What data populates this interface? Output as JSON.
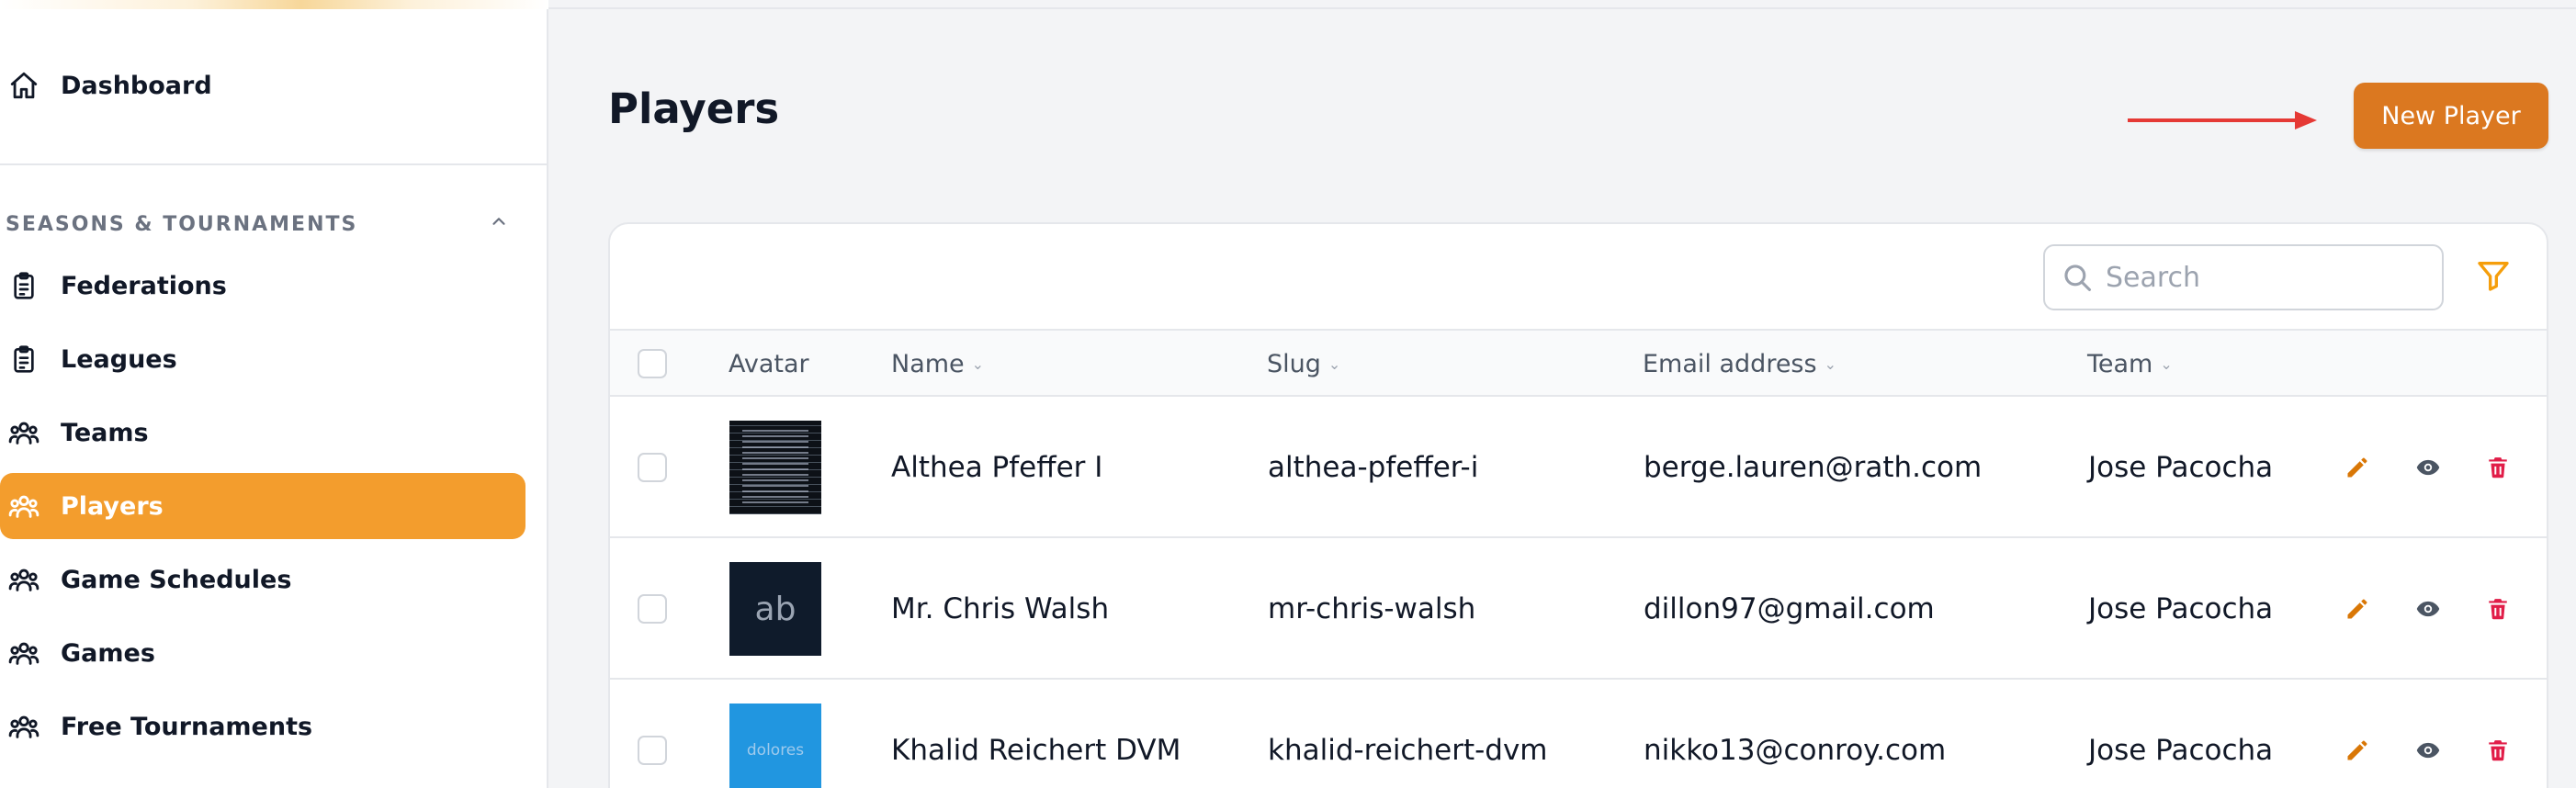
{
  "sidebar": {
    "items": [
      {
        "label": "Dashboard",
        "icon": "home-icon"
      },
      {
        "label": "Federations",
        "icon": "clipboard-icon"
      },
      {
        "label": "Leagues",
        "icon": "clipboard-icon"
      },
      {
        "label": "Teams",
        "icon": "users-icon"
      },
      {
        "label": "Players",
        "icon": "users-icon",
        "active": true
      },
      {
        "label": "Game Schedules",
        "icon": "users-icon"
      },
      {
        "label": "Games",
        "icon": "users-icon"
      },
      {
        "label": "Free Tournaments",
        "icon": "users-icon"
      }
    ],
    "section_title": "SEASONS & TOURNAMENTS",
    "section_icon": "chevron-up-icon"
  },
  "page": {
    "title": "Players",
    "new_button": "New Player"
  },
  "table": {
    "search_placeholder": "Search",
    "columns": [
      "Avatar",
      "Name",
      "Slug",
      "Email address",
      "Team"
    ],
    "rows": [
      {
        "avatar_text": "",
        "name": "Althea Pfeffer I",
        "slug": "althea-pfeffer-i",
        "email": "berge.lauren@rath.com",
        "team": "Jose Pacocha"
      },
      {
        "avatar_text": "ab",
        "name": "Mr. Chris Walsh",
        "slug": "mr-chris-walsh",
        "email": "dillon97@gmail.com",
        "team": "Jose Pacocha"
      },
      {
        "avatar_text": "dolores",
        "name": "Khalid Reichert DVM",
        "slug": "khalid-reichert-dvm",
        "email": "nikko13@conroy.com",
        "team": "Jose Pacocha"
      }
    ]
  },
  "colors": {
    "accent": "#f39d2d",
    "primary_button": "#db7820",
    "edit_icon": "#d97706",
    "view_icon": "#4b5563",
    "delete_icon": "#e11d48",
    "annotation_arrow": "#e53935"
  }
}
